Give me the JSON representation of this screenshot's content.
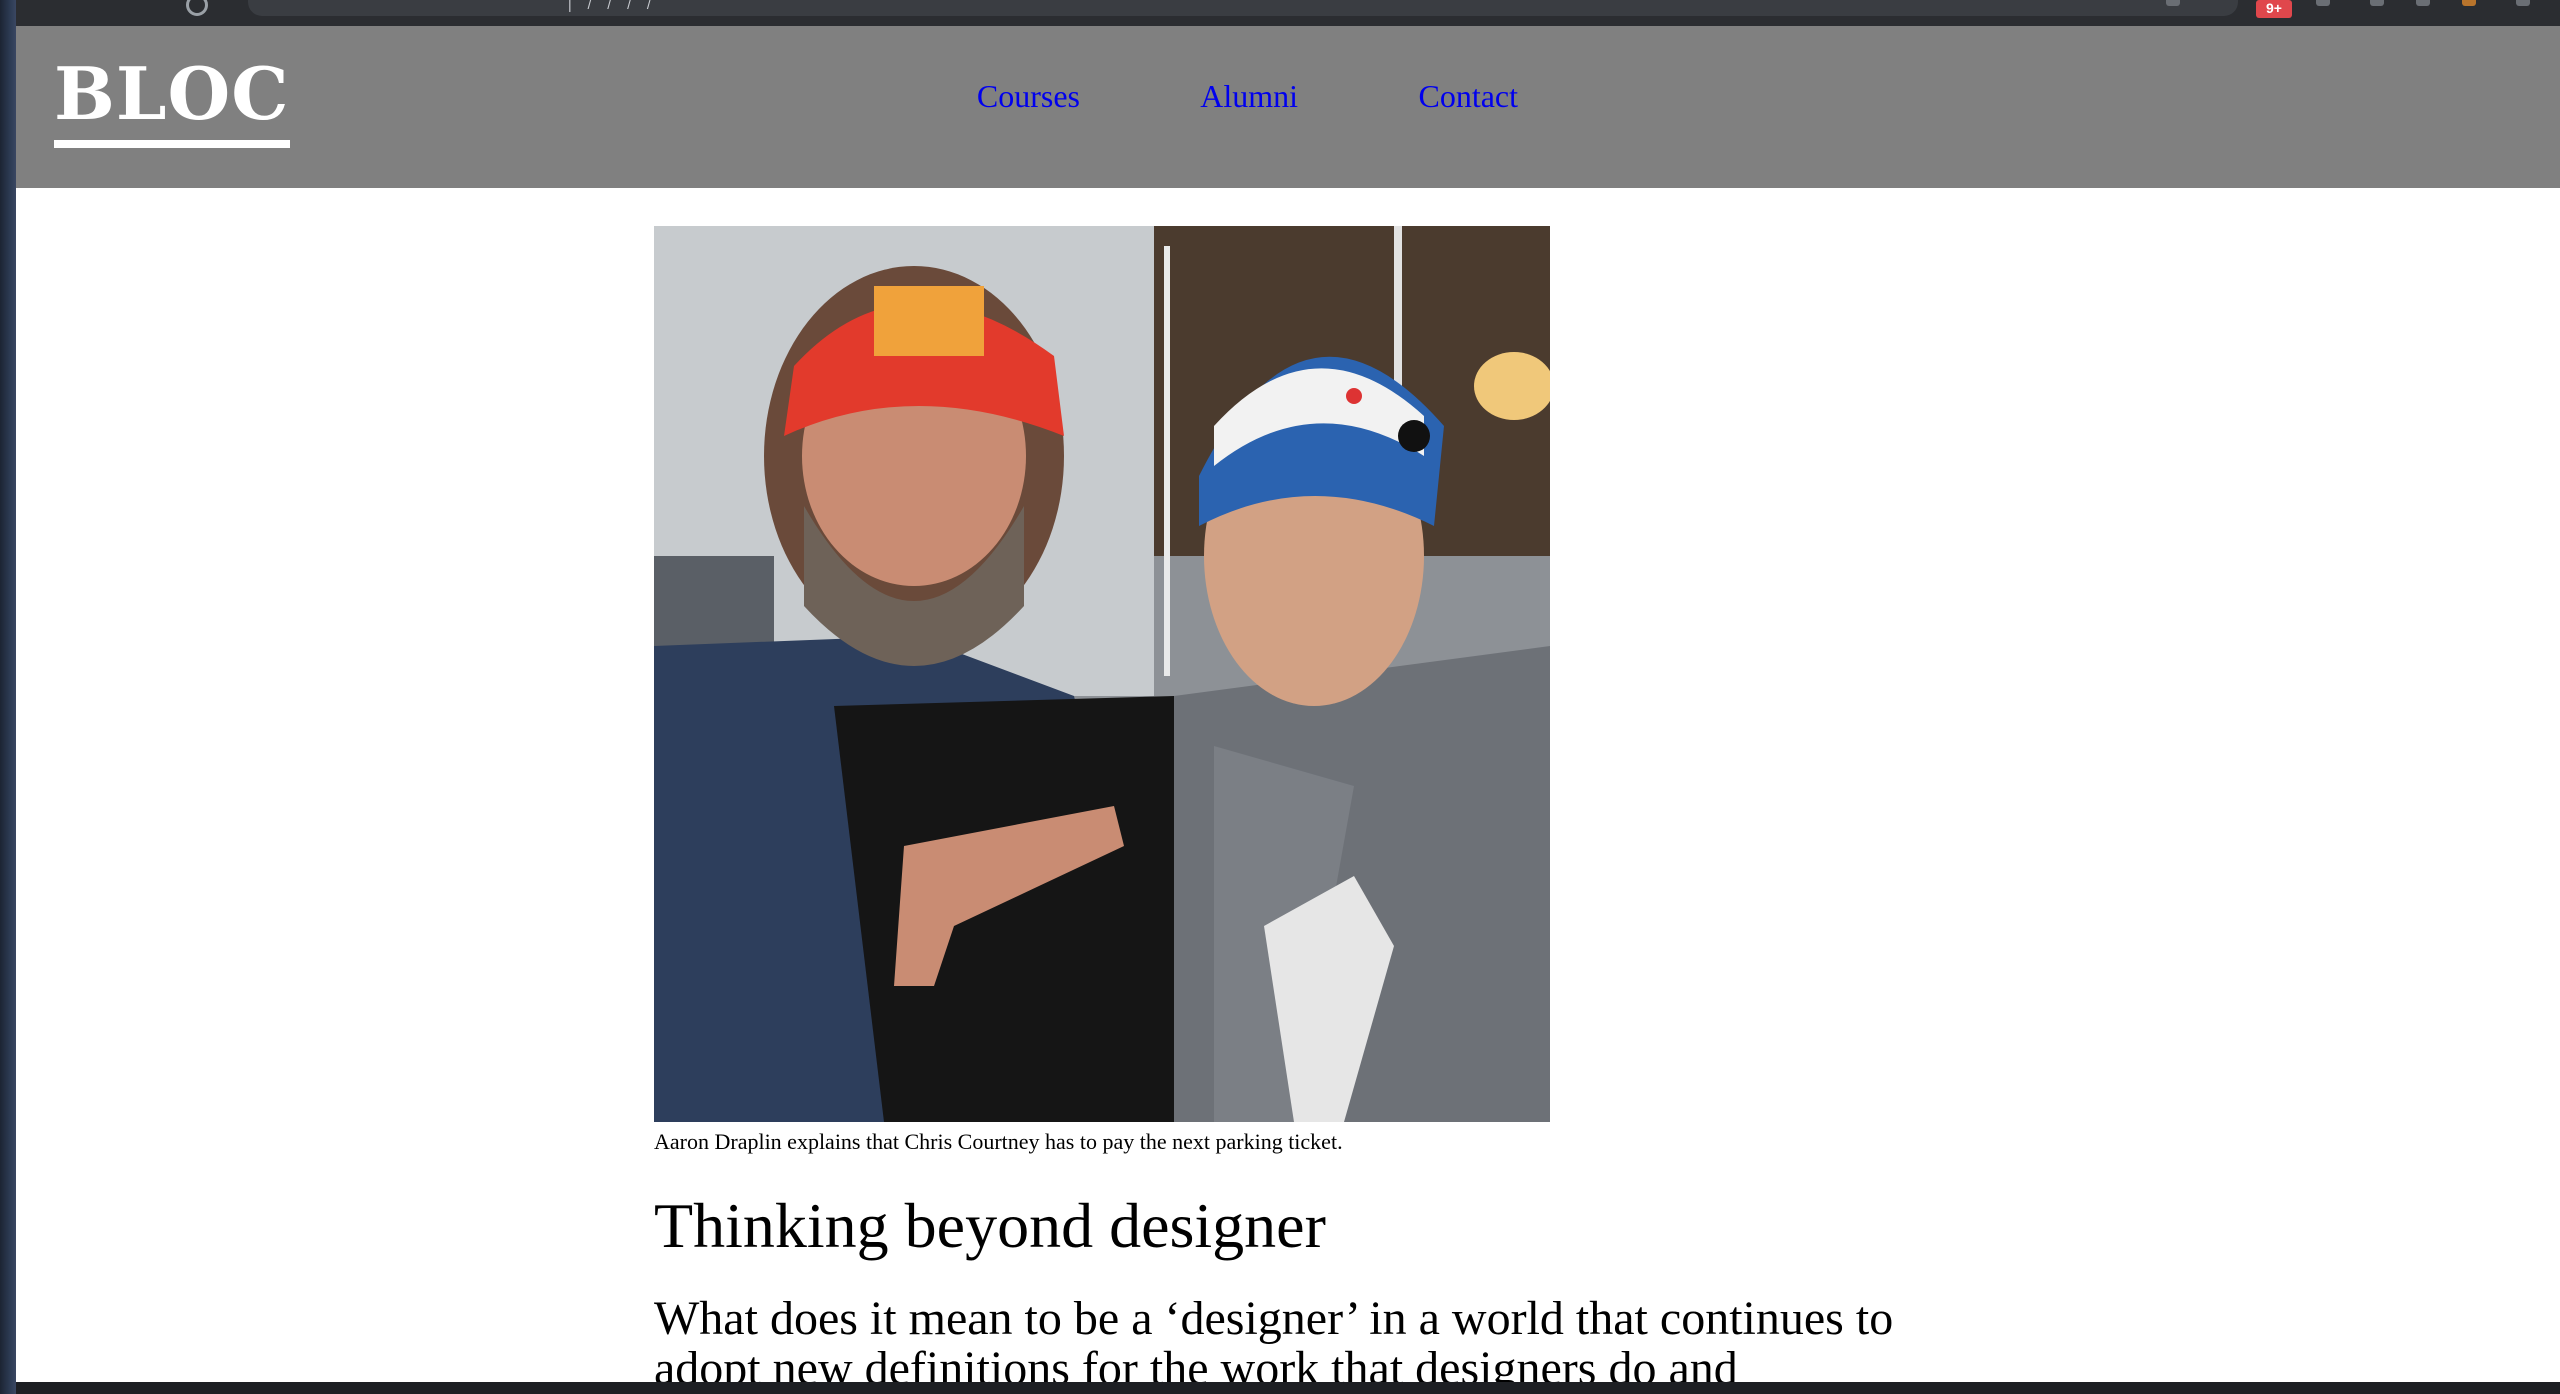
{
  "browser": {
    "url_text": "|  /  /  /  /",
    "extension_badge": "9+"
  },
  "site": {
    "logo": "BLOC",
    "nav": [
      {
        "label": "Courses"
      },
      {
        "label": "Alumni"
      },
      {
        "label": "Contact"
      }
    ]
  },
  "article": {
    "image_caption": "Aaron Draplin explains that Chris Courtney has to pay the next parking ticket.",
    "heading": "Thinking beyond designer",
    "lead": "What does it mean to be a ‘designer’ in a world that continues to adopt new definitions for the work that designers do and"
  },
  "colors": {
    "header_bg": "#808080",
    "logo": "#ffffff",
    "nav_link": "#0000ee",
    "page_bg": "#ffffff"
  }
}
